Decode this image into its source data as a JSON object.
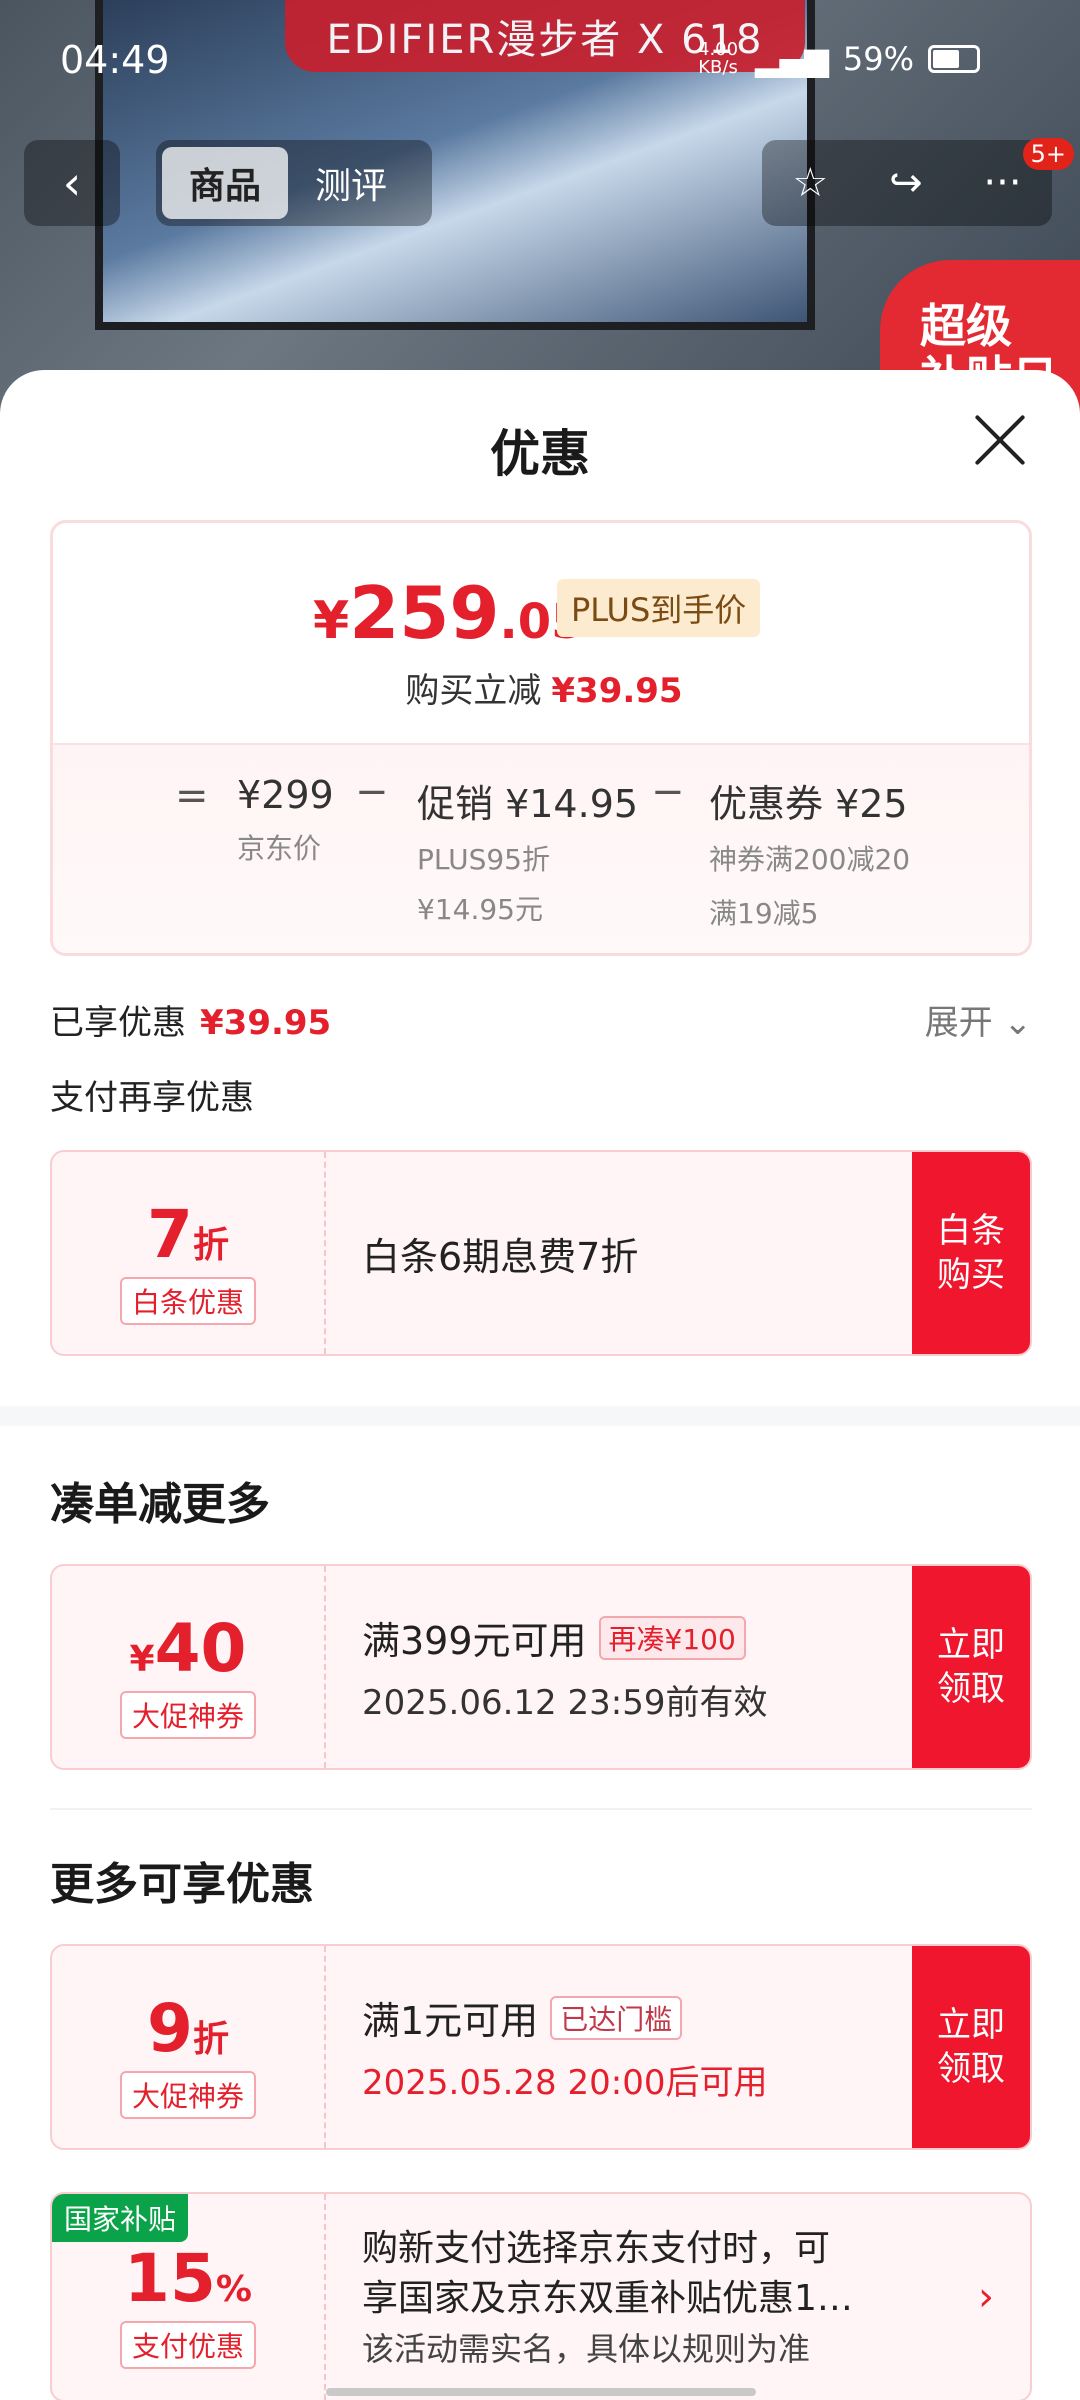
{
  "status_bar": {
    "time": "04:49",
    "net_speed": "4.00 KB/s",
    "battery": "59%"
  },
  "background": {
    "brand_text": "EDIFIER漫步者 X 618",
    "badge_text_1": "超级",
    "badge_text_2": "补贴日"
  },
  "nav": {
    "back_icon": "chevron-left-icon",
    "tabs": [
      {
        "label": "商品",
        "active": true
      },
      {
        "label": "测评",
        "active": false
      }
    ],
    "count_badge": "5+"
  },
  "sheet": {
    "title": "优惠",
    "price": {
      "currency": "¥",
      "integer": "259",
      "decimal": ".05",
      "tag": "PLUS到手价",
      "sub_label": "购买立减",
      "sub_value": "¥39.95"
    },
    "breakdown": {
      "eq": "=",
      "minus": "−",
      "base_value": "¥299",
      "base_label": "京东价",
      "promo_value": "促销 ¥14.95",
      "promo_line1": "PLUS95折",
      "promo_line2": "¥14.95元",
      "coupon_value": "优惠券 ¥25",
      "coupon_line1": "神券满200减20",
      "coupon_line2": "满19减5"
    },
    "enjoyed": {
      "label": "已享优惠",
      "value": "¥39.95",
      "expand": "展开"
    },
    "pay_more": "支付再享优惠",
    "baitiao": {
      "num": "7",
      "unit": "折",
      "tag": "白条优惠",
      "text": "白条6期息费7折",
      "button_1": "白条",
      "button_2": "购买"
    },
    "section_more": "凑单减更多",
    "coupon40": {
      "currency": "¥",
      "num": "40",
      "tag": "大促神券",
      "line1": "满399元可用",
      "mini": "再凑¥100",
      "line2": "2025.06.12 23:59前有效",
      "button_1": "立即",
      "button_2": "领取"
    },
    "section_extra": "更多可享优惠",
    "coupon9": {
      "num": "9",
      "unit": "折",
      "tag": "大促神券",
      "line1": "满1元可用",
      "mini": "已达门槛",
      "line2": "2025.05.28 20:00后可用",
      "button_1": "立即",
      "button_2": "领取"
    },
    "subsidy": {
      "badge": "国家补贴",
      "num": "15",
      "unit": "%",
      "tag": "支付优惠",
      "line1": "购新支付选择京东支付时，可",
      "line2": "享国家及京东双重补贴优惠1…",
      "line3": "该活动需实名，具体以规则为准",
      "arrow": "›"
    }
  }
}
